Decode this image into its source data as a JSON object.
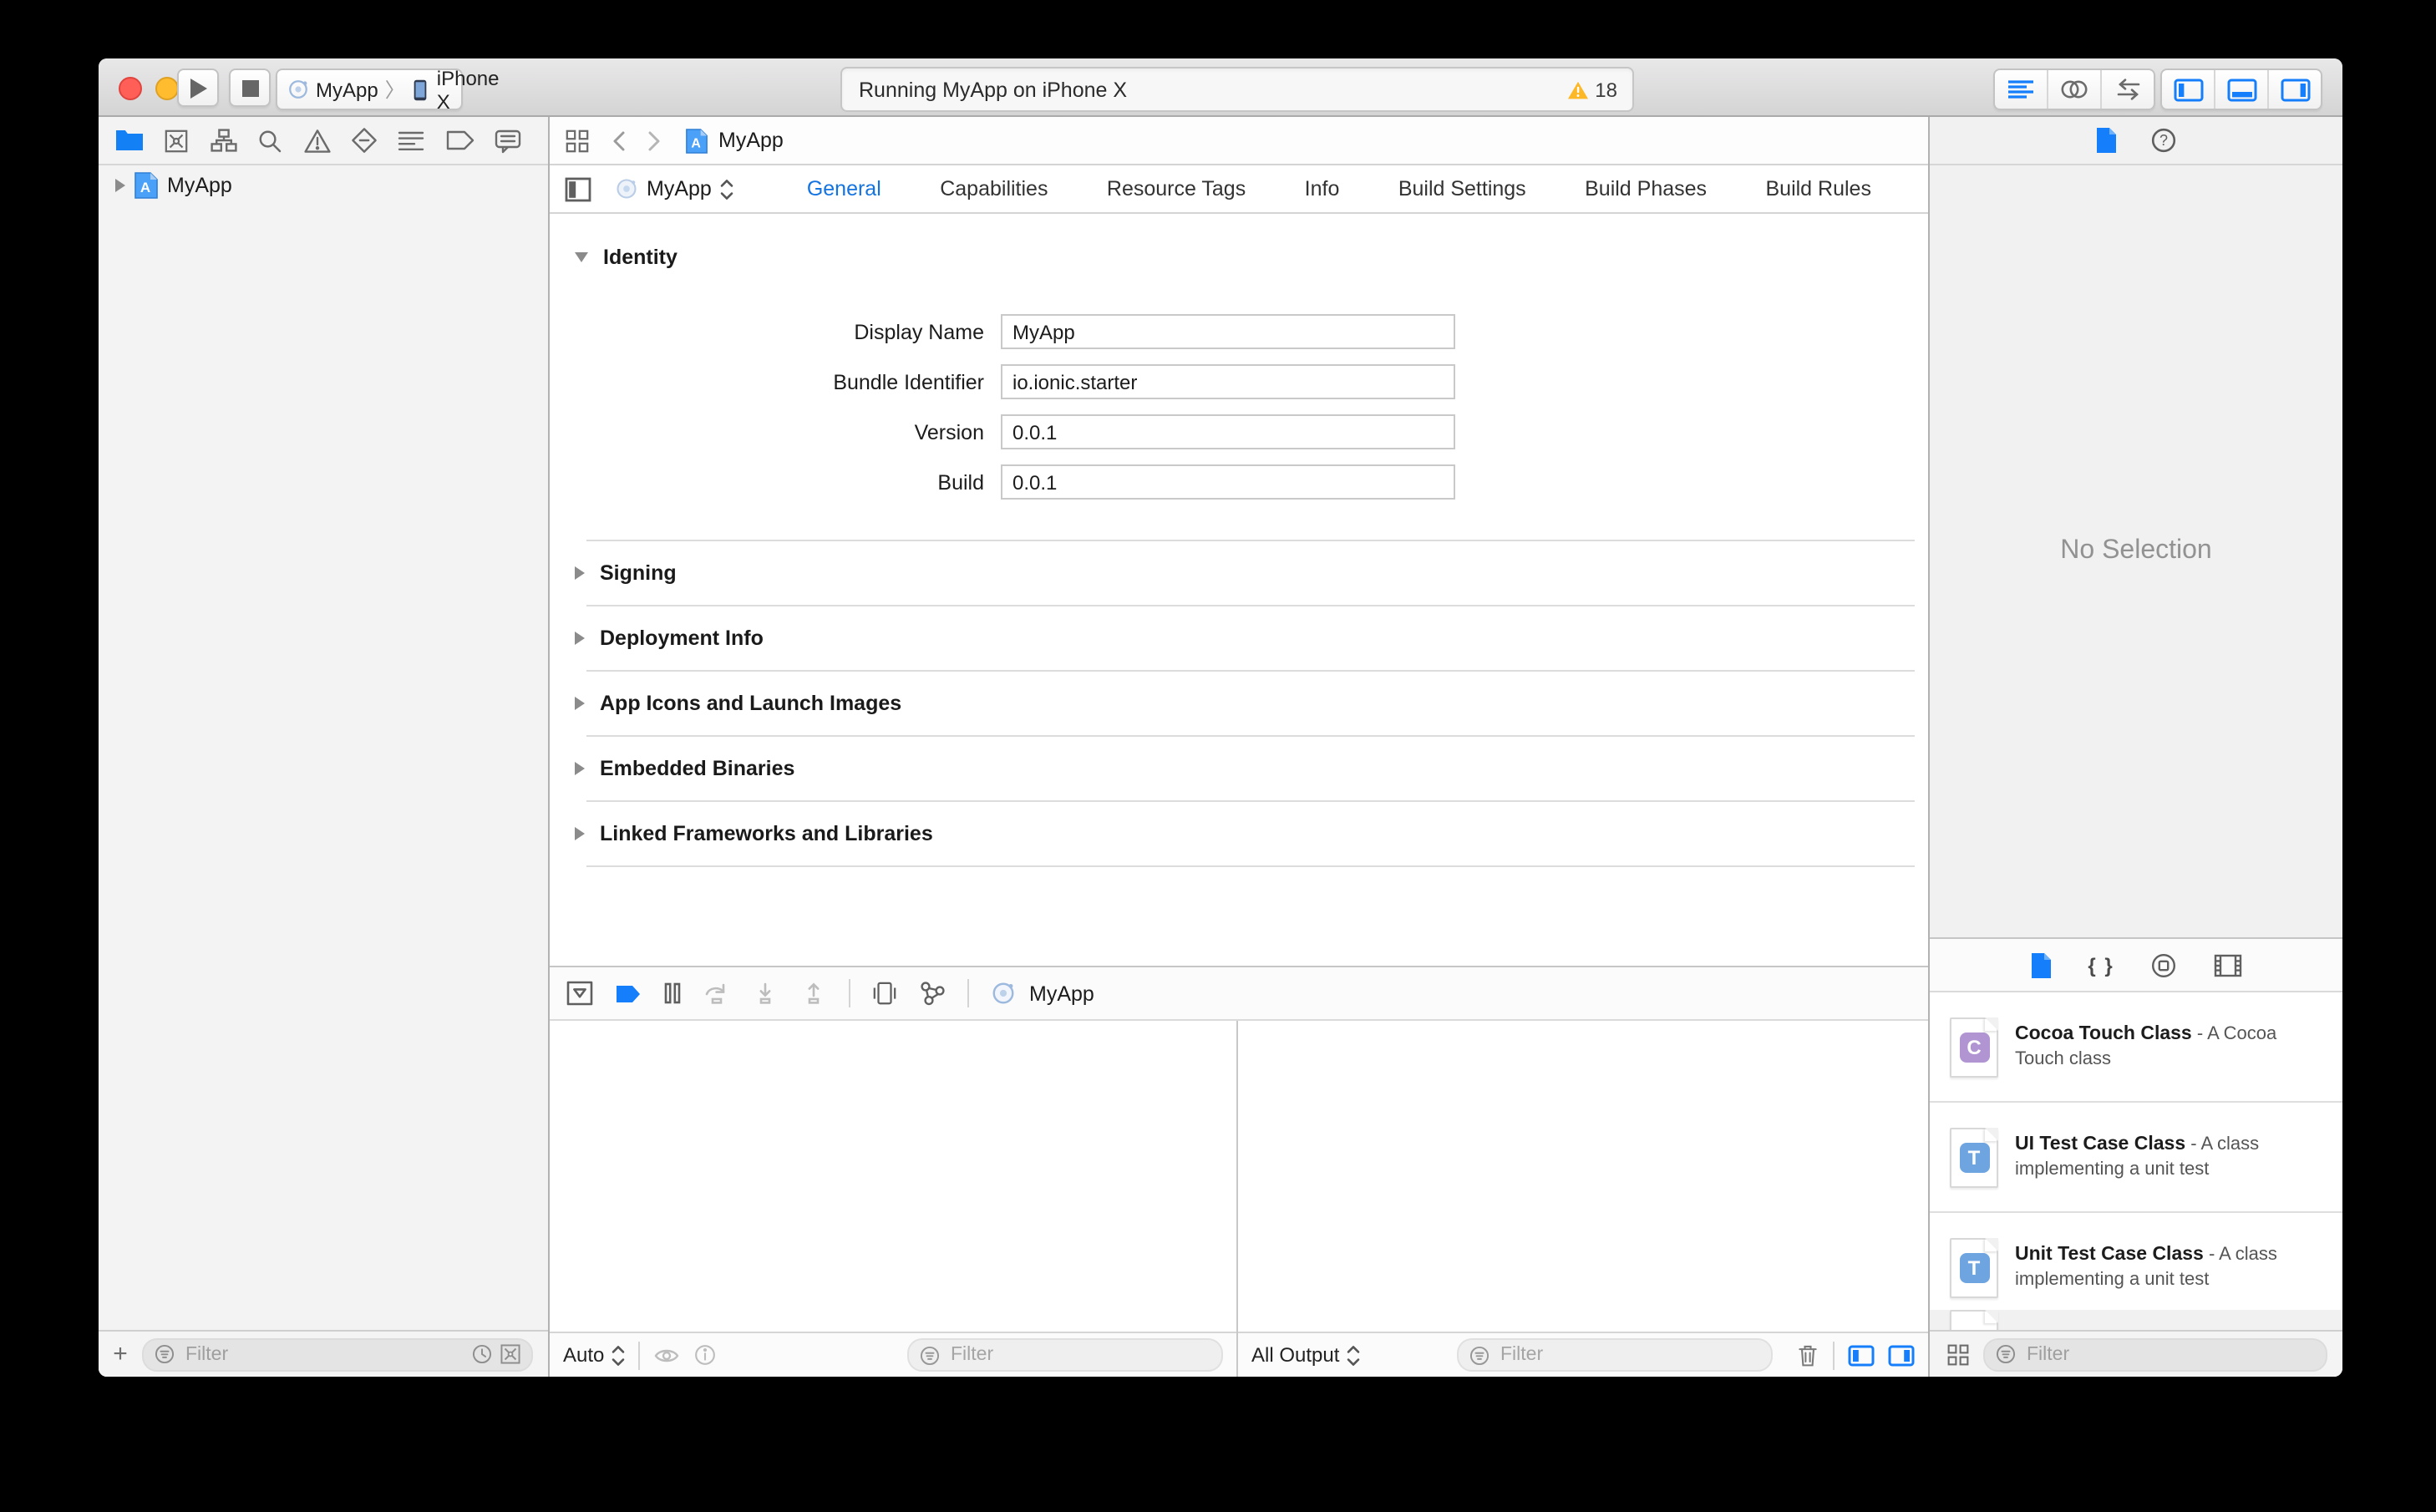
{
  "toolbar": {
    "scheme": {
      "project": "MyApp",
      "device": "iPhone X"
    },
    "status": {
      "message": "Running MyApp on iPhone X",
      "warning_count": "18"
    },
    "icons": [
      "run-icon",
      "stop-icon",
      "standard-editor-icon",
      "assistant-editor-icon",
      "version-editor-icon",
      "navigator-toggle-icon",
      "debug-area-toggle-icon",
      "utilities-toggle-icon"
    ]
  },
  "navigator": {
    "icons": [
      "project-navigator-icon",
      "source-control-navigator-icon",
      "symbol-navigator-icon",
      "find-navigator-icon",
      "issue-navigator-icon",
      "test-navigator-icon",
      "debug-navigator-icon",
      "breakpoint-navigator-icon",
      "report-navigator-icon"
    ],
    "active_icon": "project-navigator-icon",
    "project_name": "MyApp",
    "filter_placeholder": "Filter"
  },
  "editor": {
    "jump_file": "MyApp",
    "target_selector": "MyApp",
    "tabs": [
      {
        "label": "General",
        "active": true
      },
      {
        "label": "Capabilities"
      },
      {
        "label": "Resource Tags"
      },
      {
        "label": "Info"
      },
      {
        "label": "Build Settings"
      },
      {
        "label": "Build Phases"
      },
      {
        "label": "Build Rules"
      }
    ],
    "identity": {
      "title": "Identity",
      "fields": [
        {
          "label": "Display Name",
          "value": "MyApp"
        },
        {
          "label": "Bundle Identifier",
          "value": "io.ionic.starter"
        },
        {
          "label": "Version",
          "value": "0.0.1"
        },
        {
          "label": "Build",
          "value": "0.0.1"
        }
      ]
    },
    "collapsed_sections": [
      {
        "label": "Signing"
      },
      {
        "label": "Deployment Info"
      },
      {
        "label": "App Icons and Launch Images"
      },
      {
        "label": "Embedded Binaries"
      },
      {
        "label": "Linked Frameworks and Libraries"
      }
    ]
  },
  "debug": {
    "toolbar_icons": [
      "hide-debug-area-icon",
      "breakpoints-icon",
      "pause-icon",
      "step-over-icon",
      "step-into-icon",
      "step-out-icon",
      "view-debugger-icon",
      "memory-graph-icon",
      "app-icon"
    ],
    "app_name": "MyApp",
    "variables": {
      "scope": "Auto",
      "filter_placeholder": "Filter"
    },
    "console": {
      "scope": "All Output",
      "filter_placeholder": "Filter"
    }
  },
  "inspector": {
    "icons": [
      "file-inspector-icon",
      "help-inspector-icon"
    ],
    "empty_message": "No Selection"
  },
  "library": {
    "toolbar_icons": [
      "file-template-library-icon",
      "code-snippet-library-icon",
      "object-library-icon",
      "media-library-icon"
    ],
    "items": [
      {
        "letter": "C",
        "color": "#b095d2",
        "title": "Cocoa Touch Class",
        "desc": " - A Cocoa Touch class"
      },
      {
        "letter": "T",
        "color": "#6ea5e0",
        "title": "UI Test Case Class",
        "desc": " - A class implementing a unit test"
      },
      {
        "letter": "T",
        "color": "#6ea5e0",
        "title": "Unit Test Case Class",
        "desc": " - A class implementing a unit test"
      }
    ],
    "filter_placeholder": "Filter"
  },
  "colors": {
    "accent": "#157efb",
    "warning": "#fdb827"
  }
}
